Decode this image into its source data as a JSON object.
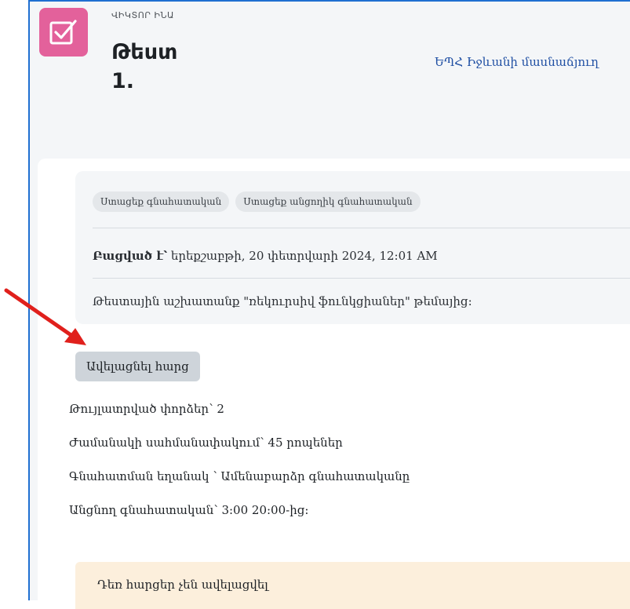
{
  "header": {
    "activity_prefix": "ՎԻԿՏՈՐ ԻՆԱ",
    "title": "Թեստ 1.",
    "course_link": "ԵՊՀ Իջևանի մասնաճյուղ"
  },
  "completion_badges": [
    "Ստացեք գնահատական",
    "Ստացեք անցողիկ գնահատական"
  ],
  "opened": {
    "label": "Բացված է՝",
    "value": "երեքշաբթի, 20 փետրվարի 2024, 12:01 AM"
  },
  "description": "Թեստային աշխատանք \"ռեկուրսիվ ֆունկցիաներ\" թեմայից:",
  "add_question_button": "Ավելացնել հարց",
  "quiz_meta": [
    "Թույլատրված փորձեր՝ 2",
    "Ժամանակի սահմանափակում՝ 45 րոպեներ",
    "Գնահատման եղանակ ՝ Ամենաբարձր գնահատականը",
    "Անցնող գնահատական՝ 3:00 20:00-ից:"
  ],
  "notice": "Դեռ հարցեր չեն ավելացվել",
  "colors": {
    "accent_border": "#1f6fd1",
    "activity_icon": "#e3619b",
    "arrow": "#e0201c",
    "notice_bg": "#fcefdc"
  },
  "icons": {
    "activity": "checkbox-icon",
    "annotation": "red-arrow-icon"
  }
}
